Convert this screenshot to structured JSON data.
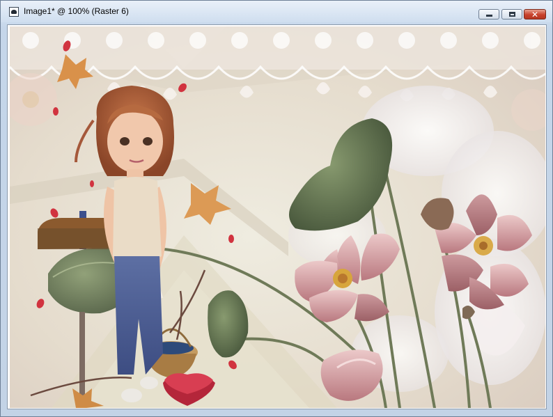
{
  "window": {
    "title": "Image1* @ 100% (Raster 6)",
    "icon": "app-document-icon",
    "controls": {
      "minimize": "minimize-icon",
      "maximize": "maximize-icon",
      "close": "close-icon"
    }
  },
  "colors": {
    "title_bar": "#d9e5f3",
    "close_button": "#c8412b",
    "artwork_bg": "#e8e2d3",
    "lotus_pink": "#d7a3a6",
    "leaf_green": "#5b6b4c"
  }
}
